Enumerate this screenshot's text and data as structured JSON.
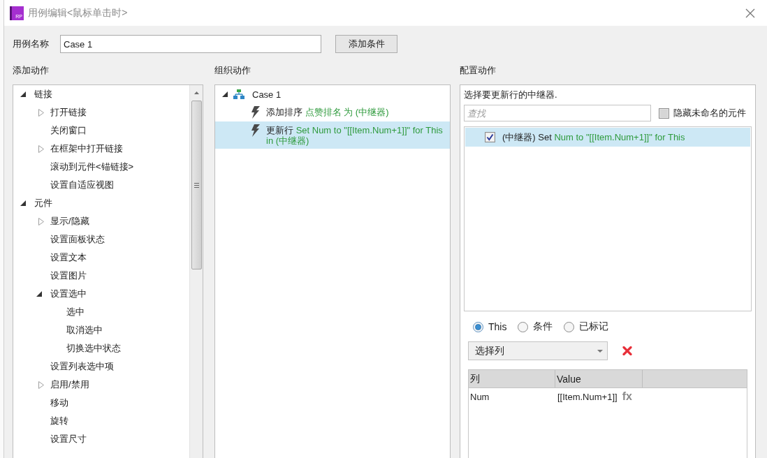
{
  "window": {
    "icon_text": "RP",
    "title": "用例编辑<鼠标单击时>"
  },
  "case_name": {
    "label": "用例名称",
    "value": "Case 1"
  },
  "add_condition_button": {
    "label": "添加条件"
  },
  "add_actions": {
    "heading": "添加动作",
    "tree": [
      {
        "label": "链接",
        "expanded": true,
        "children": [
          {
            "label": "打开链接",
            "expanded": false
          },
          {
            "label": "关闭窗口"
          },
          {
            "label": "在框架中打开链接",
            "expanded": false
          },
          {
            "label": "滚动到元件<锚链接>"
          },
          {
            "label": "设置自适应视图"
          }
        ]
      },
      {
        "label": "元件",
        "expanded": true,
        "children": [
          {
            "label": "显示/隐藏",
            "expanded": false
          },
          {
            "label": "设置面板状态"
          },
          {
            "label": "设置文本"
          },
          {
            "label": "设置图片"
          },
          {
            "label": "设置选中",
            "expanded": true,
            "children": [
              {
                "label": "选中"
              },
              {
                "label": "取消选中"
              },
              {
                "label": "切换选中状态"
              }
            ]
          },
          {
            "label": "设置列表选中项"
          },
          {
            "label": "启用/禁用",
            "expanded": false
          },
          {
            "label": "移动"
          },
          {
            "label": "旋转"
          },
          {
            "label": "设置尺寸"
          }
        ]
      }
    ]
  },
  "organize_actions": {
    "heading": "组织动作",
    "cases": [
      {
        "label": "Case 1",
        "expanded": true,
        "actions": [
          {
            "name": "添加排序",
            "detail": "点赞排名 为 (中继器)",
            "selected": false
          },
          {
            "name": "更新行",
            "detail": "Set Num to \"[[Item.Num+1]]\" for This in (中继器)",
            "selected": true
          }
        ]
      }
    ]
  },
  "configure_action": {
    "heading": "配置动作",
    "prompt": "选择要更新行的中继器.",
    "search": {
      "placeholder": "查找"
    },
    "hide_unnamed": {
      "label": "隐藏未命名的元件",
      "checked": false
    },
    "targets": [
      {
        "name": "(中继器) Set",
        "detail": "Num to \"[[Item.Num+1]]\" for This",
        "checked": true,
        "selected": true
      }
    ],
    "scope": [
      {
        "label": "This",
        "selected": true
      },
      {
        "label": "条件",
        "selected": false
      },
      {
        "label": "已标记",
        "selected": false
      }
    ],
    "column_select": {
      "value": "选择列"
    },
    "table": {
      "columns": [
        "列",
        "Value"
      ],
      "rows": [
        {
          "column": "Num",
          "value": "[[Item.Num+1]]",
          "formula_button": "fx"
        }
      ]
    }
  }
}
